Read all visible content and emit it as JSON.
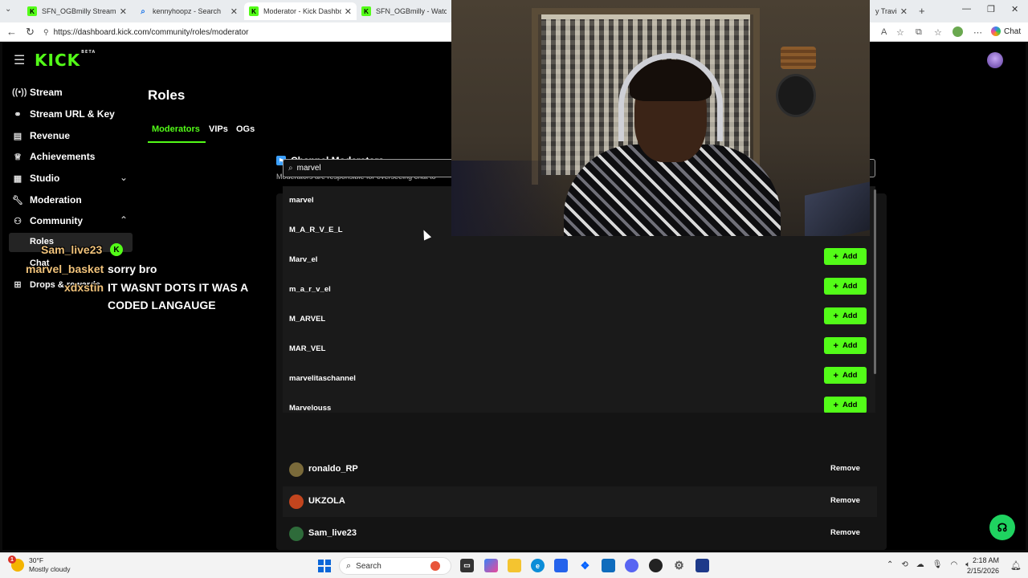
{
  "browser": {
    "tabs": [
      {
        "title": "SFN_OGBmilly Stream -",
        "active": false
      },
      {
        "title": "kennyhoopz - Search",
        "active": false
      },
      {
        "title": "Moderator - Kick Dashboard",
        "active": true
      },
      {
        "title": "SFN_OGBmilly - Watch clips",
        "active": false
      },
      {
        "title": "y Travis Sc",
        "active": false
      }
    ],
    "url": "https://dashboard.kick.com/community/roles/moderator",
    "chat_label": "Chat"
  },
  "kick": {
    "logo": "KICK",
    "logo_badge": "BETA",
    "sidebar": {
      "items": [
        {
          "label": "Stream",
          "icon": "broadcast-icon"
        },
        {
          "label": "Stream URL & Key",
          "icon": "link-icon"
        },
        {
          "label": "Revenue",
          "icon": "chart-icon"
        },
        {
          "label": "Achievements",
          "icon": "trophy-icon"
        },
        {
          "label": "Studio",
          "icon": "grid-icon"
        },
        {
          "label": "Moderation",
          "icon": "wrench-icon"
        },
        {
          "label": "Community",
          "icon": "people-icon"
        }
      ],
      "community_sub": [
        "Roles",
        "Chat"
      ],
      "drops_label": "Drops & rewards"
    },
    "page_title": "Roles",
    "role_tabs": [
      "Moderators",
      "VIPs",
      "OGs"
    ],
    "section_title": "Channel Moderators",
    "section_desc": "Moderators are responsible for overseeing chat to",
    "search": {
      "value": "marvel",
      "placeholder": "Search"
    },
    "search_results": [
      "marvel",
      "M_A_R_V_E_L",
      "Marv_el",
      "m_a_r_v_el",
      "M_ARVEL",
      "MAR_VEL",
      "marvelitaschannel",
      "Marvelouss"
    ],
    "add_label": "Add",
    "moderators": [
      {
        "name": "ronaldo_RP",
        "avatar_color": "#7a6a3a"
      },
      {
        "name": "UKZOLA",
        "avatar_color": "#c2451e"
      },
      {
        "name": "Sam_live23",
        "avatar_color": "#2e6b3a"
      }
    ],
    "remove_label": "Remove"
  },
  "chat_overlay": [
    {
      "user": "Sam_live23",
      "color": "#f0c27a",
      "message": ""
    },
    {
      "user": "marvel_basket",
      "color": "#f0c27a",
      "message": "sorry bro"
    },
    {
      "user": "xdxstin",
      "color": "#f0c27a",
      "message": "IT WASNT DOTS IT WAS A CODED LANGAUGE"
    }
  ],
  "taskbar": {
    "weather_temp": "30°F",
    "weather_desc": "Mostly cloudy",
    "weather_badge": "1",
    "search_label": "Search",
    "time": "2:18 AM",
    "date": "2/15/2026"
  }
}
